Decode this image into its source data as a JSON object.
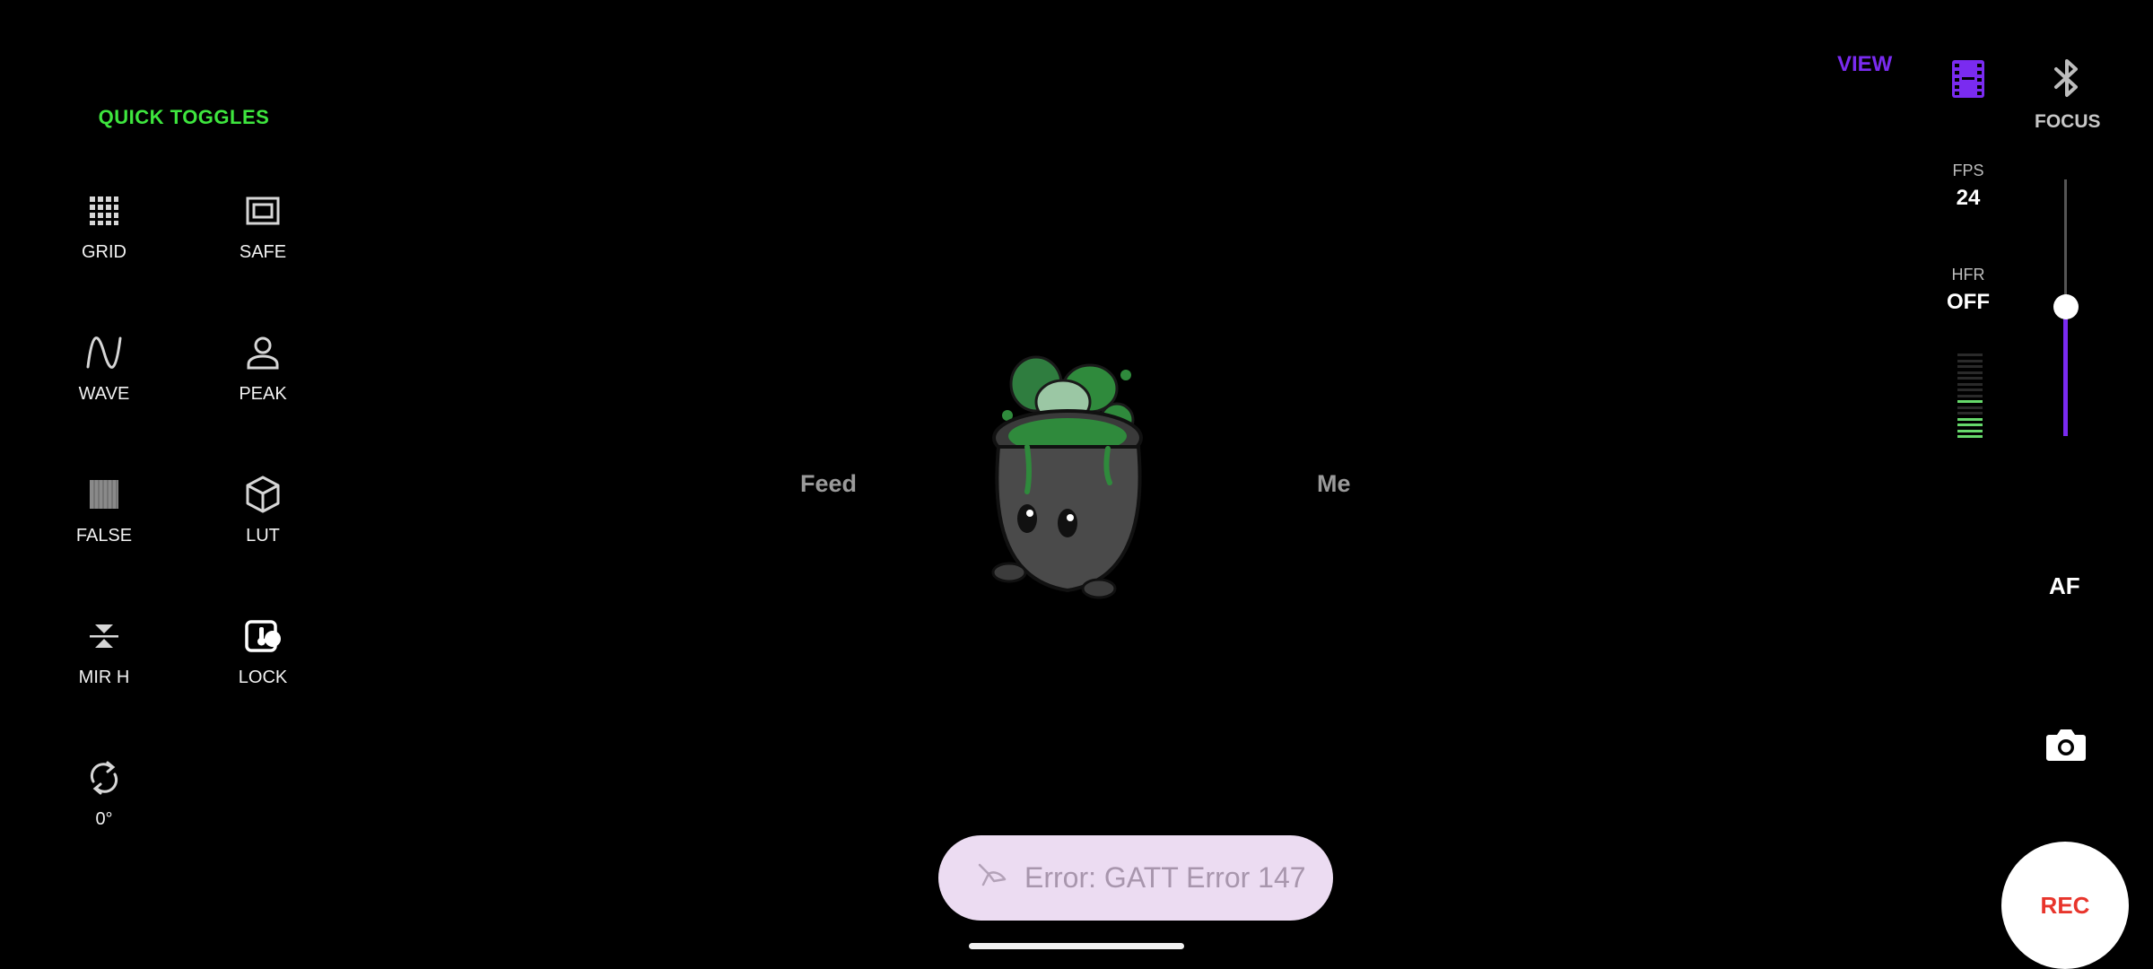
{
  "quick_toggles": {
    "title": "QUICK TOGGLES",
    "items": [
      {
        "label": "GRID",
        "icon": "grid-icon"
      },
      {
        "label": "SAFE",
        "icon": "safe-frame-icon"
      },
      {
        "label": "WAVE",
        "icon": "waveform-icon"
      },
      {
        "label": "PEAK",
        "icon": "person-icon"
      },
      {
        "label": "FALSE",
        "icon": "false-color-icon"
      },
      {
        "label": "LUT",
        "icon": "cube-icon"
      },
      {
        "label": "MIR H",
        "icon": "mirror-horizontal-icon"
      },
      {
        "label": "LOCK",
        "icon": "exposure-lock-icon"
      },
      {
        "label": "0°",
        "icon": "rotate-icon"
      }
    ]
  },
  "center": {
    "feed_label": "Feed",
    "me_label": "Me",
    "mascot_icon": "cauldron-mascot-icon"
  },
  "toast": {
    "message": "Error: GATT Error 147",
    "icon": "bird-icon"
  },
  "right_panel": {
    "view_label": "VIEW",
    "film_icon": "film-strip-icon",
    "bluetooth_icon": "bluetooth-icon",
    "focus_label": "FOCUS",
    "fps_label": "FPS",
    "fps_value": "24",
    "hfr_label": "HFR",
    "hfr_value": "OFF",
    "focus_slider_level": 0.5,
    "af_label": "AF",
    "camera_icon": "camera-icon",
    "rec_label": "REC"
  },
  "colors": {
    "accent_green": "#3ee63e",
    "accent_purple": "#7a2bf0",
    "rec_red": "#e8352c",
    "toast_bg": "#ecdcf2"
  }
}
